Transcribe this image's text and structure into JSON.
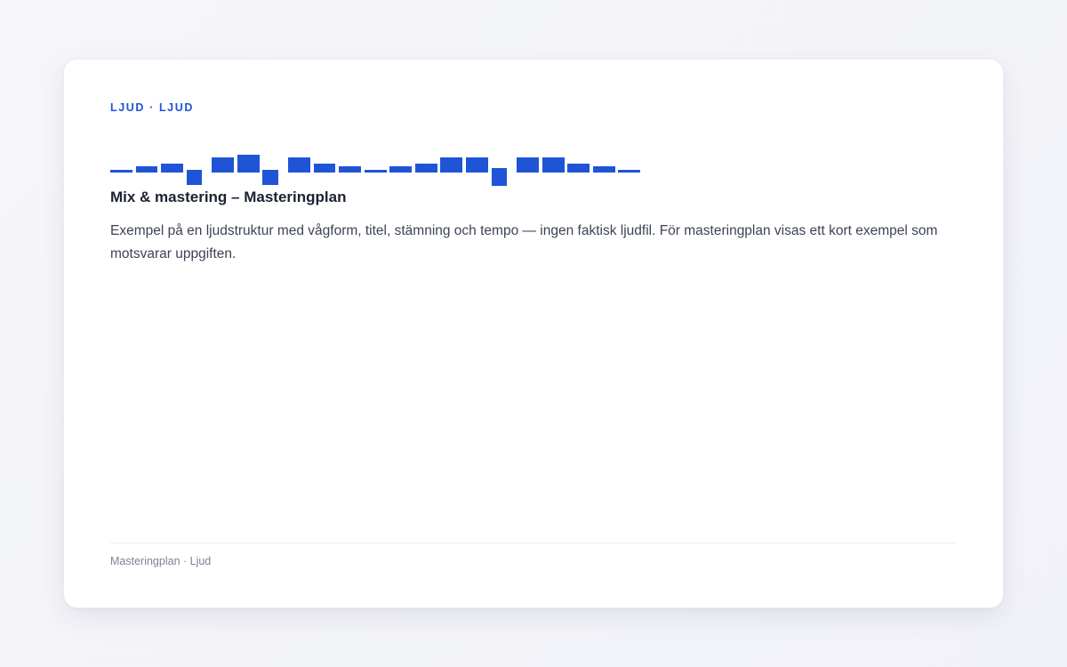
{
  "card": {
    "eyebrow": "LJUD · LJUD",
    "title": "Mix & mastering – Masteringplan",
    "description": "Exempel på en ljudstruktur med vågform, titel, stämning och tempo — ingen faktisk ljudfil. För masteringplan visas ett kort exempel som motsvarar uppgiften.",
    "footer": "Masteringplan · Ljud"
  },
  "waveform": {
    "color": "#1f54d6",
    "levels": [
      0.1,
      0.2,
      0.3,
      0.5,
      0.5,
      0.6,
      0.5,
      0.5,
      0.3,
      0.2,
      0.1,
      0.2,
      0.3,
      0.5,
      0.5,
      0.6,
      0.5,
      0.5,
      0.3,
      0.2,
      0.1
    ]
  }
}
